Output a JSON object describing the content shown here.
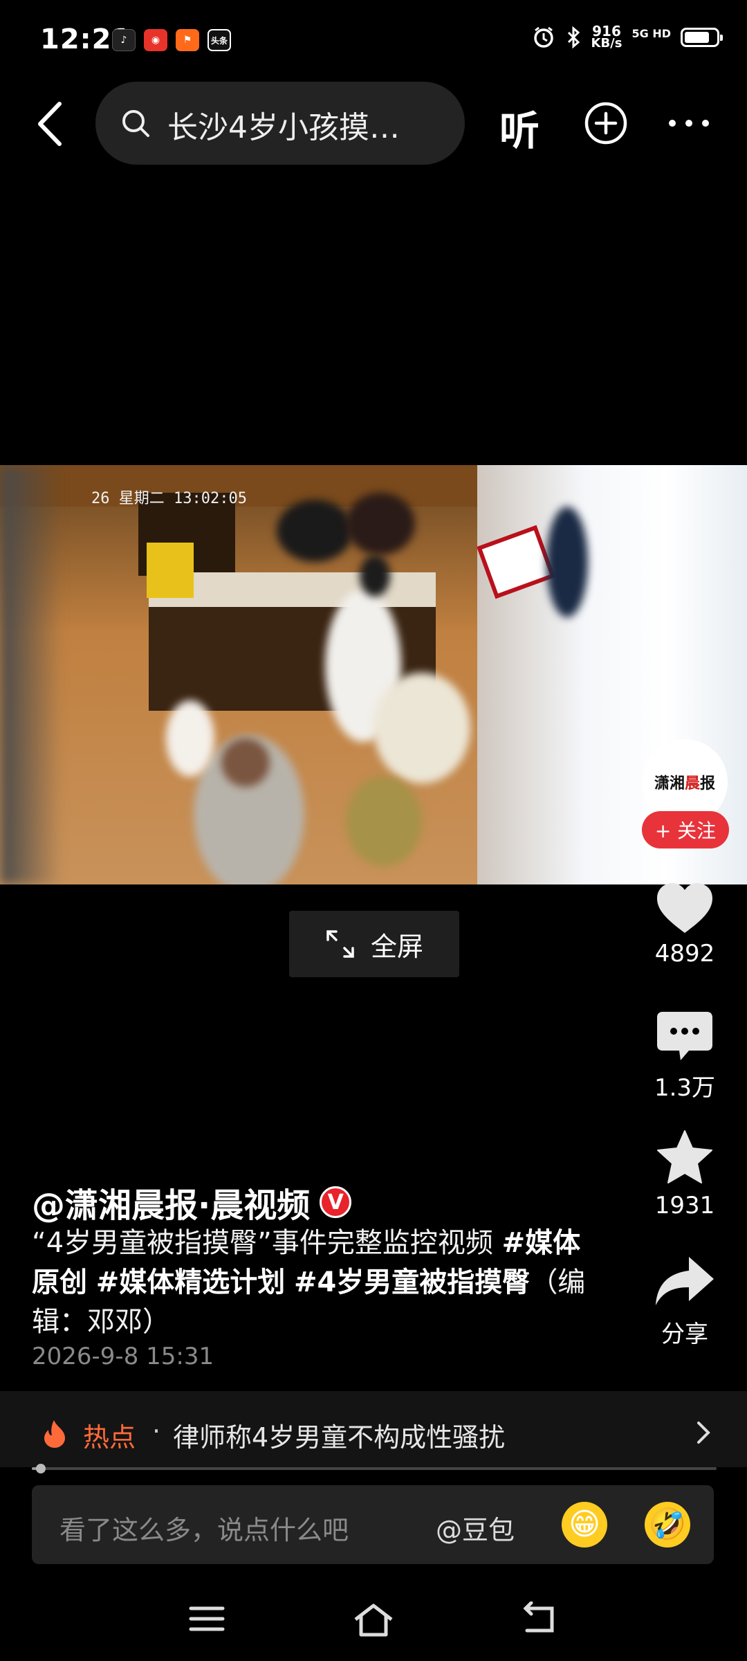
{
  "status_bar": {
    "time": "12:21",
    "app_icons": [
      {
        "name": "douyin-app-icon",
        "label": "",
        "color": "#222222"
      },
      {
        "name": "news-app-icon",
        "label": "",
        "color": "#e8332a"
      },
      {
        "name": "flag-app-icon",
        "label": "",
        "color": "#ff6a1a"
      },
      {
        "name": "toutiao-app-icon",
        "label": "头条",
        "color": "#111111"
      }
    ],
    "net_speed_value": "916",
    "net_speed_unit": "KB/s",
    "network_label": "5G HD",
    "battery_percent": 80
  },
  "top_nav": {
    "search_text": "长沙4岁小孩摸…",
    "listen_label": "听"
  },
  "video": {
    "overlay_text": "26 星期二 13:02:05"
  },
  "channel": {
    "logo_text_a": "潇湘",
    "logo_text_b": "晨",
    "logo_text_c": "报",
    "follow_label": "+ 关注"
  },
  "fullscreen": {
    "label": "全屏"
  },
  "actions": {
    "likes": "4892",
    "comments": "1.3万",
    "favorites": "1931",
    "share": "分享"
  },
  "post": {
    "author": "@潇湘晨报·晨视频",
    "verified_badge": "V",
    "desc_text": "“4岁男童被指摸臀”事件完整监控视频",
    "tags": [
      "#媒体原创",
      "#媒体精选计划",
      "#4岁男童被指摸臀"
    ],
    "editor_note": "（编辑：邓邓）",
    "date": "2026-9-8 15:31"
  },
  "hot_topic": {
    "label": "热点",
    "separator": "·",
    "text": "律师称4岁男童不构成性骚扰"
  },
  "playback": {
    "progress_fraction": 0.008
  },
  "comment_box": {
    "placeholder": "看了这么多，说点什么吧",
    "mention": "@豆包"
  },
  "colors": {
    "background": "#000000",
    "follow_red": "#e8333b",
    "hot_orange": "#ff6a3a",
    "panel": "#232323"
  }
}
